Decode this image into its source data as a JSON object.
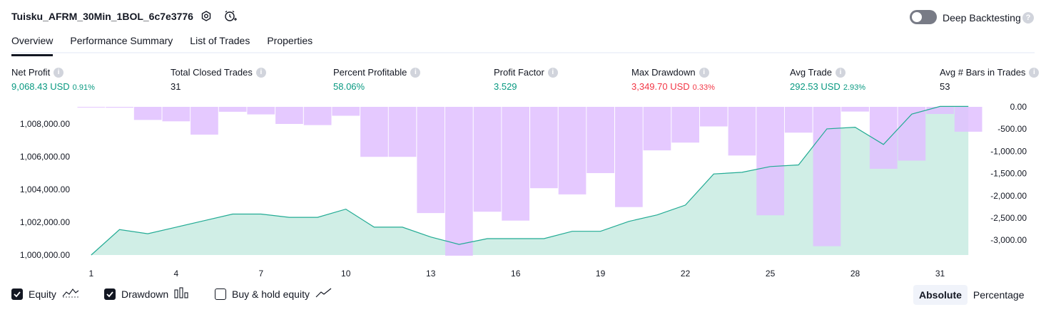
{
  "header": {
    "strategy_name": "Tuisku_AFRM_30Min_1BOL_6c7e3776",
    "deep_backtesting_label": "Deep Backtesting"
  },
  "tabs": [
    {
      "label": "Overview",
      "active": true
    },
    {
      "label": "Performance Summary",
      "active": false
    },
    {
      "label": "List of Trades",
      "active": false
    },
    {
      "label": "Properties",
      "active": false
    }
  ],
  "metrics": {
    "net_profit": {
      "label": "Net Profit",
      "value": "9,068.43 USD",
      "pct": "0.91%"
    },
    "total_closed_trades": {
      "label": "Total Closed Trades",
      "value": "31"
    },
    "percent_profitable": {
      "label": "Percent Profitable",
      "value": "58.06%"
    },
    "profit_factor": {
      "label": "Profit Factor",
      "value": "3.529"
    },
    "max_drawdown": {
      "label": "Max Drawdown",
      "value": "3,349.70 USD",
      "pct": "0.33%"
    },
    "avg_trade": {
      "label": "Avg Trade",
      "value": "292.53 USD",
      "pct": "2.93%"
    },
    "avg_bars": {
      "label": "Avg # Bars in Trades",
      "value": "53"
    }
  },
  "legend": {
    "equity_label": "Equity",
    "drawdown_label": "Drawdown",
    "buy_hold_label": "Buy & hold equity",
    "equity_checked": true,
    "drawdown_checked": true,
    "buy_hold_checked": false
  },
  "view_toggle": {
    "absolute_label": "Absolute",
    "percentage_label": "Percentage",
    "selected": "Absolute"
  },
  "colors": {
    "equity_line": "#22ab94",
    "equity_fill": "#c8ebe2",
    "drawdown_bar": "#e1bfff",
    "axis_text": "#131722"
  },
  "chart_data": {
    "type": "area",
    "x": [
      1,
      2,
      3,
      4,
      5,
      6,
      7,
      8,
      9,
      10,
      11,
      12,
      13,
      14,
      15,
      16,
      17,
      18,
      19,
      20,
      21,
      22,
      23,
      24,
      25,
      26,
      27,
      28,
      29,
      30,
      31,
      32
    ],
    "x_ticks": [
      "1",
      "4",
      "7",
      "10",
      "13",
      "16",
      "19",
      "22",
      "25",
      "28",
      "31"
    ],
    "series": [
      {
        "name": "Equity",
        "axis": "left",
        "values": [
          1000000,
          1001550,
          1001300,
          1001700,
          1002100,
          1002500,
          1002500,
          1002300,
          1002300,
          1002800,
          1001700,
          1001700,
          1001100,
          1000650,
          1001000,
          1001000,
          1001000,
          1001450,
          1001450,
          1002050,
          1002450,
          1003050,
          1004950,
          1005050,
          1005400,
          1005500,
          1007700,
          1007800,
          1006750,
          1008600,
          1009068,
          1009068
        ]
      },
      {
        "name": "Drawdown",
        "axis": "right",
        "type": "bar",
        "values": [
          -10,
          -20,
          -295,
          -325,
          -625,
          -110,
          -170,
          -385,
          -410,
          -200,
          -1125,
          -1125,
          -2390,
          -3350,
          -2360,
          -2560,
          -1830,
          -1970,
          -1490,
          -2255,
          -980,
          -805,
          -440,
          -1095,
          -2440,
          -580,
          -3135,
          -105,
          -1395,
          -1210,
          -160,
          -560
        ]
      }
    ],
    "yleft_ticks": [
      "1,000,000.00",
      "1,002,000.00",
      "1,004,000.00",
      "1,006,000.00",
      "1,008,000.00"
    ],
    "yleft_range": [
      1000000,
      1009068
    ],
    "yright_ticks": [
      "0.00",
      "-500.00",
      "-1,000.00",
      "-1,500.00",
      "-2,000.00",
      "-2,500.00",
      "-3,000.00"
    ],
    "yright_range": [
      -3350,
      0
    ]
  }
}
